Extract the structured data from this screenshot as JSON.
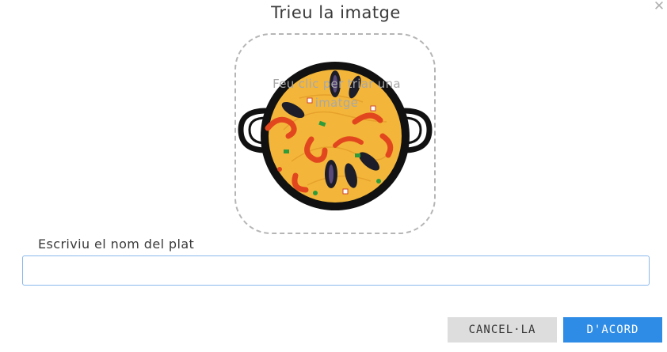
{
  "dialog": {
    "title": "Trieu la imatge",
    "close_icon": "close-icon"
  },
  "image_picker": {
    "hint": "Feu clic per triar una imatge",
    "image_icon": "paella-pan-image"
  },
  "name_field": {
    "label": "Escriviu el nom del plat",
    "value": "",
    "placeholder": ""
  },
  "buttons": {
    "cancel_label": "CANCEL·LA",
    "ok_label": "D'ACORD"
  },
  "colors": {
    "accent": "#2f8ce6",
    "cancel_bg": "#dddddd",
    "input_border": "#8ab8ec",
    "paella_rice": "#f3b63a"
  }
}
